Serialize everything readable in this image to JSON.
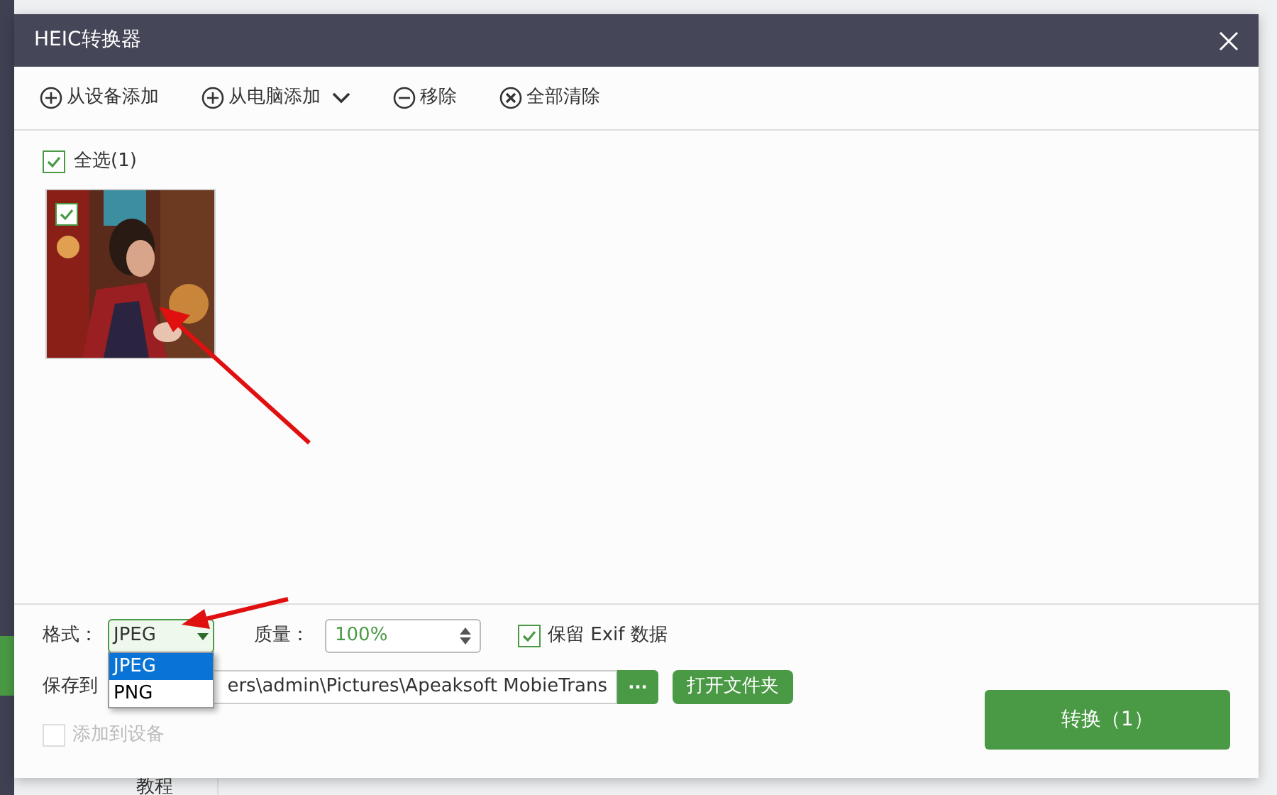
{
  "background": {
    "sidebar_label": "教程"
  },
  "window": {
    "title": "HEIC转换器"
  },
  "toolbar": [
    {
      "kind": "plus",
      "label": "从设备添加",
      "dropdown": false
    },
    {
      "kind": "plus",
      "label": "从电脑添加",
      "dropdown": true
    },
    {
      "kind": "minus",
      "label": "移除",
      "dropdown": false
    },
    {
      "kind": "clear",
      "label": "全部清除",
      "dropdown": false
    }
  ],
  "select_all": {
    "label": "全选(1)",
    "checked": true
  },
  "photos": [
    {
      "kind": "picture",
      "checked": true
    }
  ],
  "format": {
    "label": "格式：",
    "value": "JPEG",
    "options": [
      {
        "label": "JPEG",
        "selected": true
      },
      {
        "label": "PNG",
        "selected": false
      }
    ]
  },
  "quality": {
    "label": "质量：",
    "value": "100%"
  },
  "keep_exif": {
    "label": "保留 Exif 数据",
    "checked": true
  },
  "save_to": {
    "label": "保存到",
    "path": "ers\\admin\\Pictures\\Apeaksoft MobieTrans",
    "browse": "···",
    "open_folder": "打开文件夹"
  },
  "add_to_device": {
    "label": "添加到设备",
    "checked": false,
    "disabled": true
  },
  "convert_button": "转换（1）"
}
